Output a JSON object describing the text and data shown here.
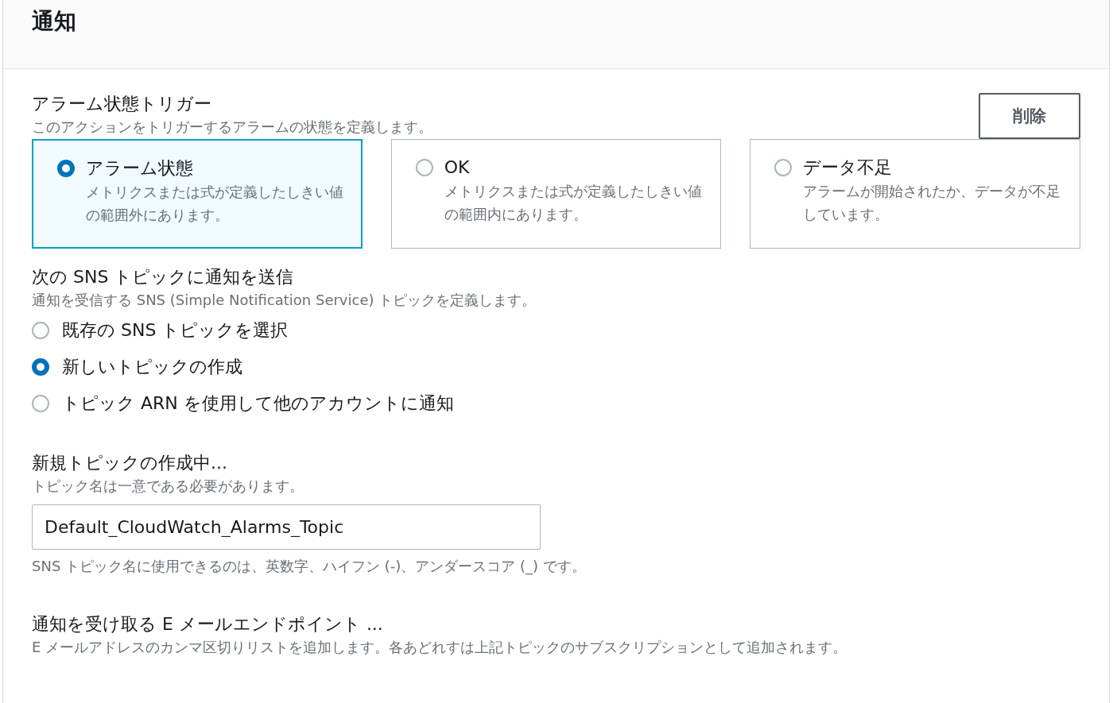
{
  "header": {
    "title": "通知"
  },
  "trigger": {
    "label": "アラーム状態トリガー",
    "description": "このアクションをトリガーするアラームの状態を定義します。",
    "delete_button": "削除",
    "options": [
      {
        "title": "アラーム状態",
        "description": "メトリクスまたは式が定義したしきい値の範囲外にあります。",
        "selected": true
      },
      {
        "title": "OK",
        "description": "メトリクスまたは式が定義したしきい値の範囲内にあります。",
        "selected": false
      },
      {
        "title": "データ不足",
        "description": "アラームが開始されたか、データが不足しています。",
        "selected": false
      }
    ]
  },
  "sns": {
    "label": "次の SNS トピックに通知を送信",
    "description": "通知を受信する SNS (Simple Notification Service) トピックを定義します。",
    "options": [
      {
        "label": "既存の SNS トピックを選択",
        "selected": false
      },
      {
        "label": "新しいトピックの作成",
        "selected": true
      },
      {
        "label": "トピック ARN を使用して他のアカウントに通知",
        "selected": false
      }
    ]
  },
  "new_topic": {
    "label": "新規トピックの作成中...",
    "description": "トピック名は一意である必要があります。",
    "value": "Default_CloudWatch_Alarms_Topic",
    "hint": "SNS トピック名に使用できるのは、英数字、ハイフン (-)、アンダースコア (_) です。"
  },
  "email": {
    "label": "通知を受け取る E メールエンドポイント ...",
    "description": "E メールアドレスのカンマ区切りリストを追加します。各あどれすは上記トピックのサブスクリプションとして追加されます。"
  }
}
